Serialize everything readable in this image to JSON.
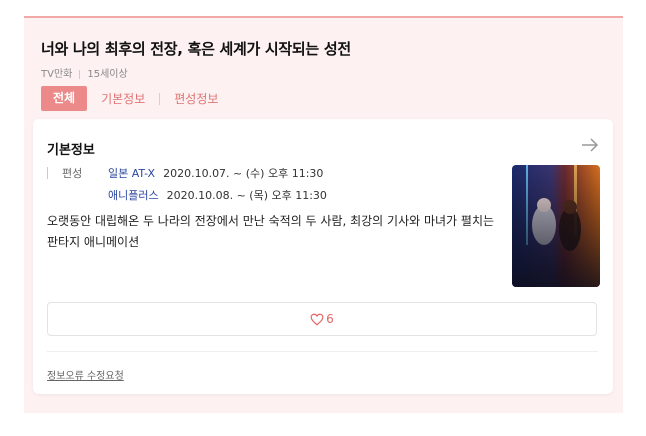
{
  "title": "너와 나의 최후의 전장, 혹은 세계가 시작되는 성전",
  "meta": {
    "category": "TV만화",
    "rating": "15세이상"
  },
  "tabs": [
    "전체",
    "기본정보",
    "편성정보"
  ],
  "card": {
    "heading": "기본정보",
    "schedule_label": "편성",
    "schedule": [
      {
        "channel": "일본 AT-X",
        "time": "2020.10.07. ~ (수) 오후 11:30"
      },
      {
        "channel": "애니플러스",
        "time": "2020.10.08. ~ (목) 오후 11:30"
      }
    ],
    "description": "오랫동안 대립해온 두 나라의 전장에서 만난 숙적의 두 사람, 최강의 기사와 마녀가 펼치는 판타지 애니메이션",
    "like_count": "6",
    "report_link": "정보오류 수정요청"
  },
  "colors": {
    "accent": "#ec8a8a",
    "panel_bg": "#fdf1f1",
    "channel_link": "#2a46a0"
  },
  "icons": [
    "arrow-right-icon",
    "heart-icon"
  ]
}
